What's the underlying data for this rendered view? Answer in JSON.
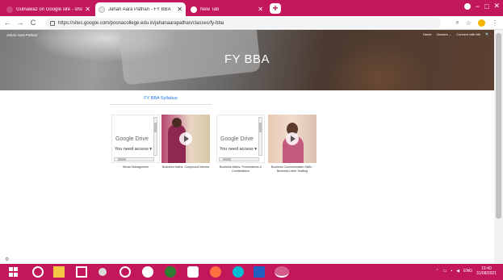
{
  "browser": {
    "tabs": [
      {
        "title": "Gulnawaz on Google site - shoai..."
      },
      {
        "title": "Jahan Aara Pathan - FY BBA"
      },
      {
        "title": "New Tab"
      }
    ],
    "new_tab_label": "+",
    "url": "https://sites.google.com/poonacollege.edu.in/jahanaarapathan/classes/fy-bba",
    "nav": {
      "back": "←",
      "forward": "→",
      "reload": "C"
    },
    "colors": {
      "accent": "#c2185b"
    }
  },
  "site": {
    "name": "Jahan Aara Pathan",
    "nav_items": [
      "Home",
      "Classes ⌄",
      "Connect with Me",
      "🔍"
    ],
    "page_title": "FY BBA",
    "syllabus_link": "FY BBA Syllabus"
  },
  "drive": {
    "logo_google": "Google",
    "logo_drive": "Drive",
    "access_message": "You need access ▾"
  },
  "items": [
    {
      "caption": "Stress Management"
    },
    {
      "caption": "Business Maths- Compound Interest"
    },
    {
      "caption": "Business Maths- Permutations & Combinations"
    },
    {
      "caption": "Business Communication Skills - Business Letter Drafting"
    }
  ],
  "taskbar": {
    "language": "ENG",
    "time": "15:40",
    "date": "31/08/2021"
  }
}
